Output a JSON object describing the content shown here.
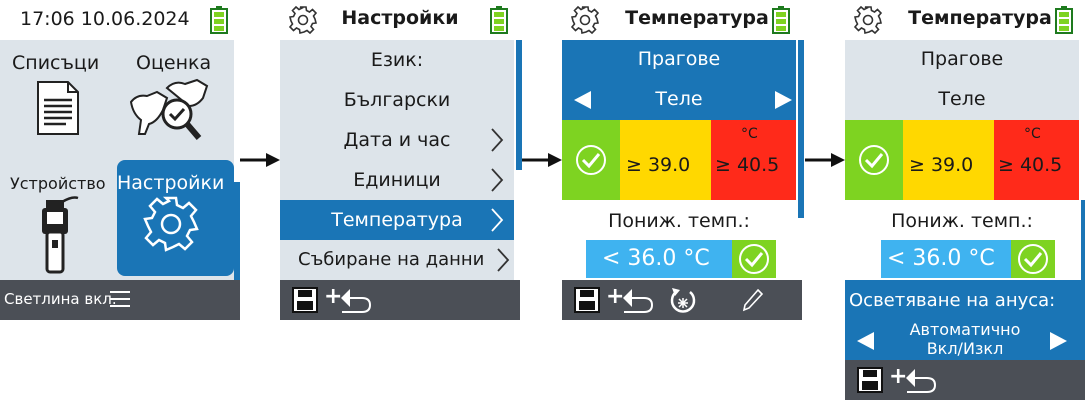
{
  "screen1": {
    "time": "17:06 10.06.2024",
    "tiles": [
      {
        "label": "Списъци"
      },
      {
        "label": "Оценка"
      },
      {
        "label": "Устройство"
      },
      {
        "label": "Настройки"
      }
    ],
    "footer": "Светлина вкл."
  },
  "screen2": {
    "title": "Настройки",
    "items": [
      "Език:",
      "Български",
      "Дата и час",
      "Единици",
      "Температура",
      "Събиране на данни"
    ]
  },
  "screen3": {
    "title": "Температура",
    "thresholds_label": "Прагове",
    "selector_value": "Теле",
    "unit": "°C",
    "threshold_mid": "≥ 39.0",
    "threshold_high": "≥ 40.5",
    "low_temp_label": "Пониж. темп.:",
    "low_temp_value": "< 36.0 °C"
  },
  "screen4": {
    "title": "Температура",
    "thresholds_label": "Прагове",
    "selector_value": "Теле",
    "unit": "°C",
    "threshold_mid": "≥ 39.0",
    "threshold_high": "≥ 40.5",
    "low_temp_label": "Пониж. темп.:",
    "low_temp_value": "< 36.0 °C",
    "anus_label": "Осветяване на ануса:",
    "anus_value_line1": "Автоматично",
    "anus_value_line2": "Вкл/Изкл"
  },
  "colors": {
    "accent": "#1a75b6",
    "panel": "#dde4ea",
    "footer": "#4b4f56",
    "green": "#7ed321",
    "yellow": "#ffd800",
    "red": "#ff2a1a",
    "light_blue": "#3fb3f0"
  }
}
